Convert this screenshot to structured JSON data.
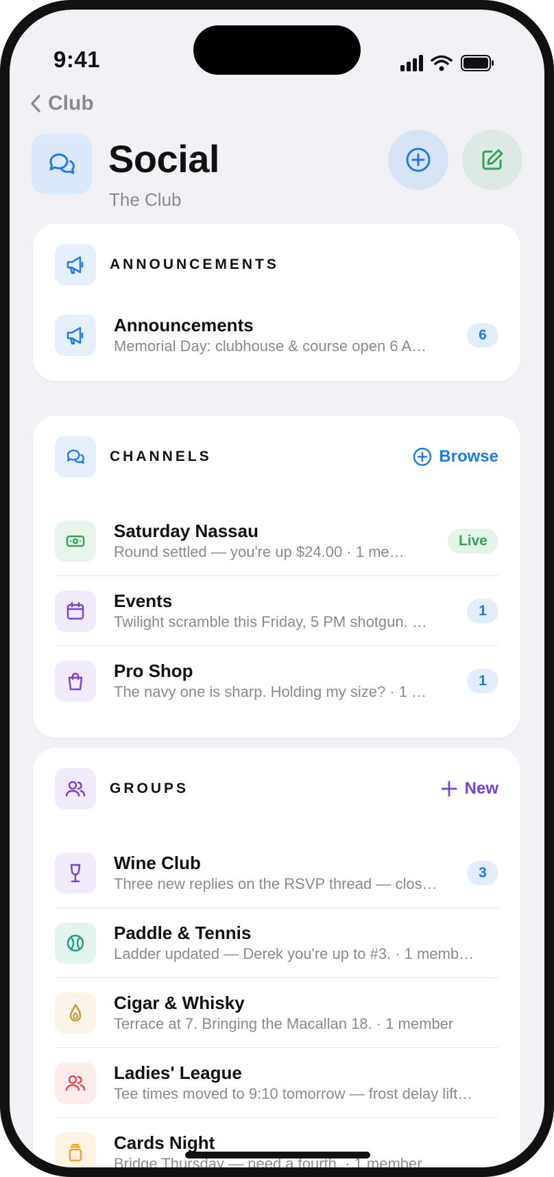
{
  "status_bar": {
    "time": "9:41"
  },
  "nav": {
    "back_label": "Club"
  },
  "header": {
    "title": "Social",
    "subtitle": "The Club",
    "icon": "chat-bubbles-icon"
  },
  "colors": {
    "accent": "#1a7bf0",
    "purple": "#7a3fd8",
    "green": "#2fa655",
    "background": "#f2f1f6"
  },
  "announcements": {
    "section_title": "ANNOUNCEMENTS",
    "items": [
      {
        "title": "Announcements",
        "subtitle": "Memorial Day: clubhouse & course open 6 A…",
        "badge": "6",
        "icon": "megaphone-icon"
      }
    ]
  },
  "channels": {
    "section_title": "CHANNELS",
    "action_label": "Browse",
    "items": [
      {
        "title": "Saturday Nassau",
        "subtitle": "Round settled — you're up $24.00  ·  1 me…",
        "badge": "Live",
        "icon": "cash-icon"
      },
      {
        "title": "Events",
        "subtitle": "Twilight scramble this Friday, 5 PM shotgun.  …",
        "badge": "1",
        "icon": "calendar-icon"
      },
      {
        "title": "Pro Shop",
        "subtitle": "The navy one is sharp. Holding my size?  ·  1 …",
        "badge": "1",
        "icon": "shopping-bag-icon"
      }
    ]
  },
  "groups": {
    "section_title": "GROUPS",
    "action_label": "New",
    "items": [
      {
        "title": "Wine Club",
        "subtitle": "Three new replies on the RSVP thread — clos…",
        "badge": "3",
        "icon": "wine-glass-icon"
      },
      {
        "title": "Paddle & Tennis",
        "subtitle": "Ladder updated — Derek you're up to #3.  ·  1 memb…",
        "badge": "",
        "icon": "tennis-ball-icon"
      },
      {
        "title": "Cigar & Whisky",
        "subtitle": "Terrace at 7. Bringing the Macallan 18.  ·  1 member",
        "badge": "",
        "icon": "flame-icon"
      },
      {
        "title": "Ladies' League",
        "subtitle": "Tee times moved to 9:10 tomorrow — frost delay lift…",
        "badge": "",
        "icon": "people-icon"
      },
      {
        "title": "Cards Night",
        "subtitle": "Bridge Thursday — need a fourth.  ·  1 member",
        "badge": "",
        "icon": "cards-icon"
      }
    ]
  }
}
